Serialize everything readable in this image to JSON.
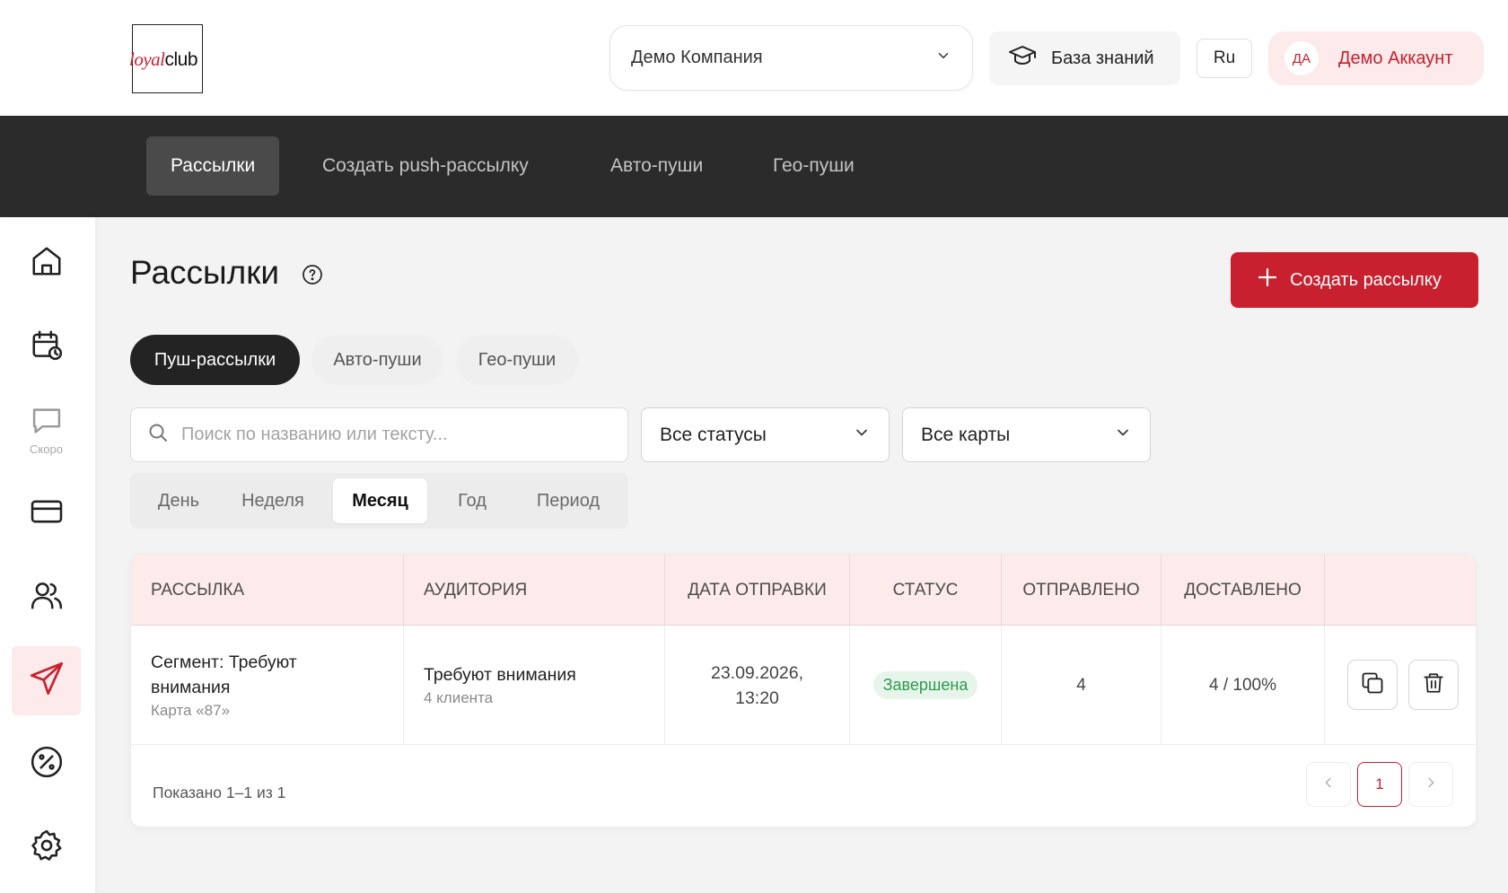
{
  "header": {
    "logo": {
      "part1": "loyal",
      "part2": "club"
    },
    "company": "Демо Компания",
    "knowledge_base": "База знаний",
    "language": "Ru",
    "account": {
      "initials": "ДА",
      "name": "Демо Аккаунт"
    }
  },
  "navbar": {
    "tabs": [
      "Рассылки",
      "Создать push-рассылку",
      "Авто-пуши",
      "Гео-пуши"
    ],
    "active": "Рассылки"
  },
  "sidebar": {
    "items": [
      {
        "icon": "home-icon"
      },
      {
        "icon": "calendar-clock-icon"
      },
      {
        "icon": "chat-icon",
        "label": "Скоро"
      },
      {
        "icon": "card-icon"
      },
      {
        "icon": "users-icon"
      },
      {
        "icon": "send-icon",
        "active": true
      },
      {
        "icon": "discount-icon"
      },
      {
        "icon": "settings-icon"
      }
    ],
    "accent_color": "#c8202f"
  },
  "main": {
    "title": "Рассылки",
    "create_button": "Создать рассылку",
    "type_tabs": [
      "Пуш-рассылки",
      "Авто-пуши",
      "Гео-пуши"
    ],
    "active_type": "Пуш-рассылки",
    "search_placeholder": "Поиск по названию или тексту...",
    "status_filter": "Все статусы",
    "cards_filter": "Все карты",
    "periods": [
      "День",
      "Неделя",
      "Месяц",
      "Год",
      "Период"
    ],
    "active_period": "Месяц"
  },
  "table": {
    "columns": [
      "РАССЫЛКА",
      "АУДИТОРИЯ",
      "ДАТА ОТПРАВКИ",
      "СТАТУС",
      "ОТПРАВЛЕНО",
      "ДОСТАВЛЕНО"
    ],
    "rows": [
      {
        "name_line1": "Сегмент: Требуют",
        "name_line2": "внимания",
        "card": "Карта «87»",
        "audience": "Требуют внимания",
        "audience_count": "4 клиента",
        "date": "23.09.2026,",
        "time": "13:20",
        "status": "Завершена",
        "sent": "4",
        "delivered": "4 / 100%"
      }
    ],
    "footer": "Показано 1–1 из 1",
    "current_page": "1"
  },
  "colors": {
    "brand": "#c8202f",
    "dark_nav": "#2b2b2b",
    "status_done": "#2e9a51"
  }
}
